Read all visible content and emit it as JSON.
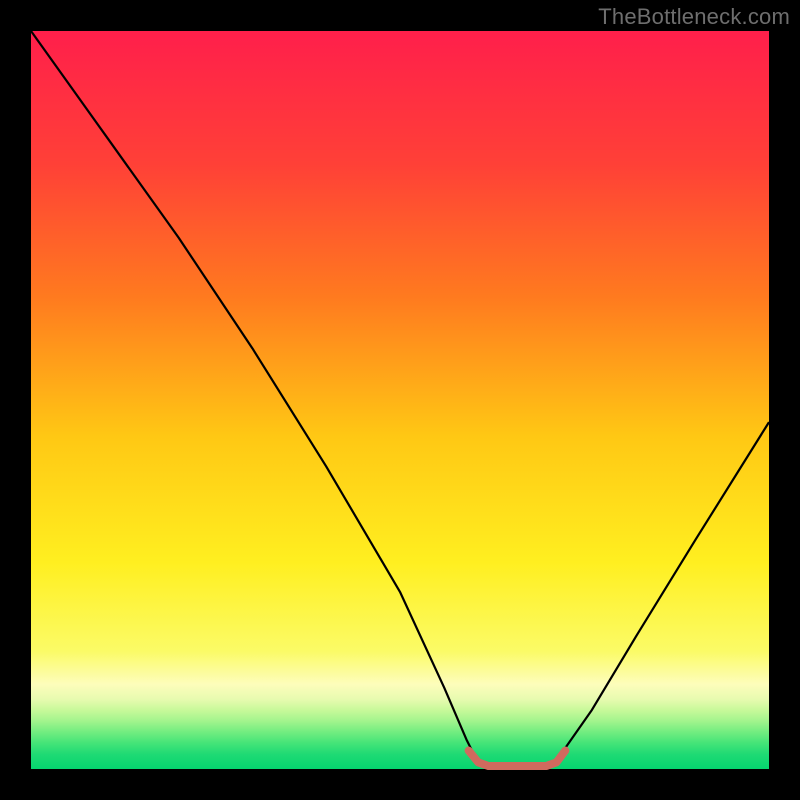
{
  "attribution": "TheBottleneck.com",
  "plot": {
    "inner": {
      "x0": 31,
      "y0": 31,
      "x1": 769,
      "y1": 769
    }
  },
  "chart_data": {
    "type": "line",
    "title": "",
    "xlabel": "",
    "ylabel": "",
    "xlim": [
      0,
      100
    ],
    "ylim": [
      0,
      100
    ],
    "grid": false,
    "legend": false,
    "annotations": [],
    "background": {
      "description": "vertical gradient red→orange→yellow→pale-yellow→green over plot area, with narrow banding near the bottom",
      "stops": [
        {
          "offset": 0.0,
          "color": "#ff1f4b"
        },
        {
          "offset": 0.18,
          "color": "#ff4037"
        },
        {
          "offset": 0.36,
          "color": "#ff7a1f"
        },
        {
          "offset": 0.55,
          "color": "#ffc814"
        },
        {
          "offset": 0.72,
          "color": "#ffef20"
        },
        {
          "offset": 0.84,
          "color": "#fbfb66"
        },
        {
          "offset": 0.885,
          "color": "#fdfdbb"
        },
        {
          "offset": 0.905,
          "color": "#e8fbb0"
        },
        {
          "offset": 0.92,
          "color": "#c8f99a"
        },
        {
          "offset": 0.935,
          "color": "#a2f48d"
        },
        {
          "offset": 0.95,
          "color": "#72ed80"
        },
        {
          "offset": 0.965,
          "color": "#44e478"
        },
        {
          "offset": 0.98,
          "color": "#1fda74"
        },
        {
          "offset": 1.0,
          "color": "#05d46f"
        }
      ]
    },
    "series": [
      {
        "name": "bottleneck-curve",
        "stroke": "#000000",
        "stroke_width": 2.2,
        "points_xy": [
          [
            0,
            100
          ],
          [
            10,
            86
          ],
          [
            20,
            72
          ],
          [
            30,
            57
          ],
          [
            40,
            41
          ],
          [
            50,
            24
          ],
          [
            56,
            11
          ],
          [
            59,
            4
          ],
          [
            60.5,
            1
          ],
          [
            61.5,
            0.2
          ],
          [
            70,
            0.2
          ],
          [
            71,
            1
          ],
          [
            72.5,
            3
          ],
          [
            76,
            8
          ],
          [
            82,
            18
          ],
          [
            90,
            31
          ],
          [
            100,
            47
          ]
        ]
      },
      {
        "name": "target-plateau",
        "stroke": "#d06a5e",
        "stroke_width": 8,
        "linecap": "round",
        "points_xy": [
          [
            59.3,
            2.5
          ],
          [
            60.6,
            0.9
          ],
          [
            62.0,
            0.4
          ],
          [
            66.0,
            0.4
          ],
          [
            69.8,
            0.4
          ],
          [
            71.2,
            0.9
          ],
          [
            72.4,
            2.5
          ]
        ]
      }
    ]
  }
}
